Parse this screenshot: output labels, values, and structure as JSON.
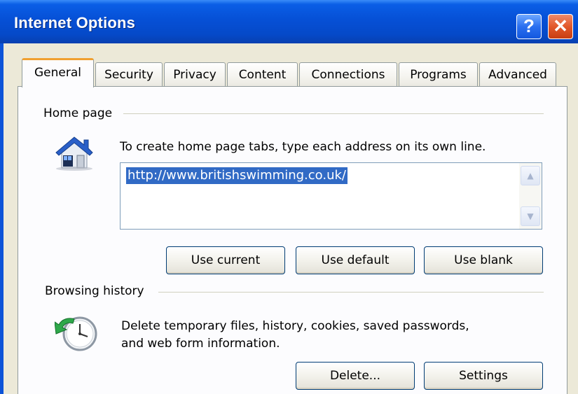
{
  "window": {
    "title": "Internet Options",
    "help_label": "?",
    "close_label": "✕"
  },
  "tabs": [
    {
      "label": "General",
      "active": true
    },
    {
      "label": "Security"
    },
    {
      "label": "Privacy"
    },
    {
      "label": "Content"
    },
    {
      "label": "Connections"
    },
    {
      "label": "Programs"
    },
    {
      "label": "Advanced"
    }
  ],
  "home_page": {
    "group_title": "Home page",
    "icon": "house-icon",
    "instructions": "To create home page tabs, type each address on its own line.",
    "address_value": "http://www.britishswimming.co.uk/",
    "buttons": {
      "use_current": "Use current",
      "use_default": "Use default",
      "use_blank": "Use blank"
    }
  },
  "browsing_history": {
    "group_title": "Browsing history",
    "icon": "history-clock-icon",
    "description_line1": "Delete temporary files, history, cookies, saved passwords,",
    "description_line2": "and web form information.",
    "buttons": {
      "delete": "Delete...",
      "settings": "Settings"
    }
  },
  "colors": {
    "titlebar": "#0650d6",
    "selection": "#316ac5",
    "active_tab_accent": "#f0a030",
    "dialog_bg": "#ece9d8"
  }
}
